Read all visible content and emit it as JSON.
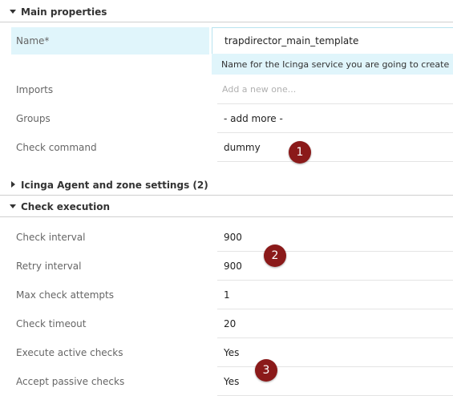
{
  "main_properties": {
    "header": "Main properties",
    "name_label": "Name*",
    "name_value": "trapdirector_main_template",
    "name_hint": "Name for the Icinga service you are going to create",
    "imports_label": "Imports",
    "imports_placeholder": "Add a new one...",
    "groups_label": "Groups",
    "groups_value": "- add more -",
    "check_command_label": "Check command",
    "check_command_value": "dummy"
  },
  "agent_zone": {
    "header": "Icinga Agent and zone settings (2)"
  },
  "check_execution": {
    "header": "Check execution",
    "rows": [
      {
        "label": "Check interval",
        "value": "900"
      },
      {
        "label": "Retry interval",
        "value": "900"
      },
      {
        "label": "Max check attempts",
        "value": "1"
      },
      {
        "label": "Check timeout",
        "value": "20"
      },
      {
        "label": "Execute active checks",
        "value": "Yes"
      },
      {
        "label": "Accept passive checks",
        "value": "Yes"
      }
    ]
  },
  "annotations": {
    "badge_1": "1",
    "badge_2": "2",
    "badge_3": "3",
    "badge_color": "#8b1a1a"
  },
  "icons": {
    "expanded": "caret-down-icon",
    "collapsed": "caret-right-icon"
  }
}
